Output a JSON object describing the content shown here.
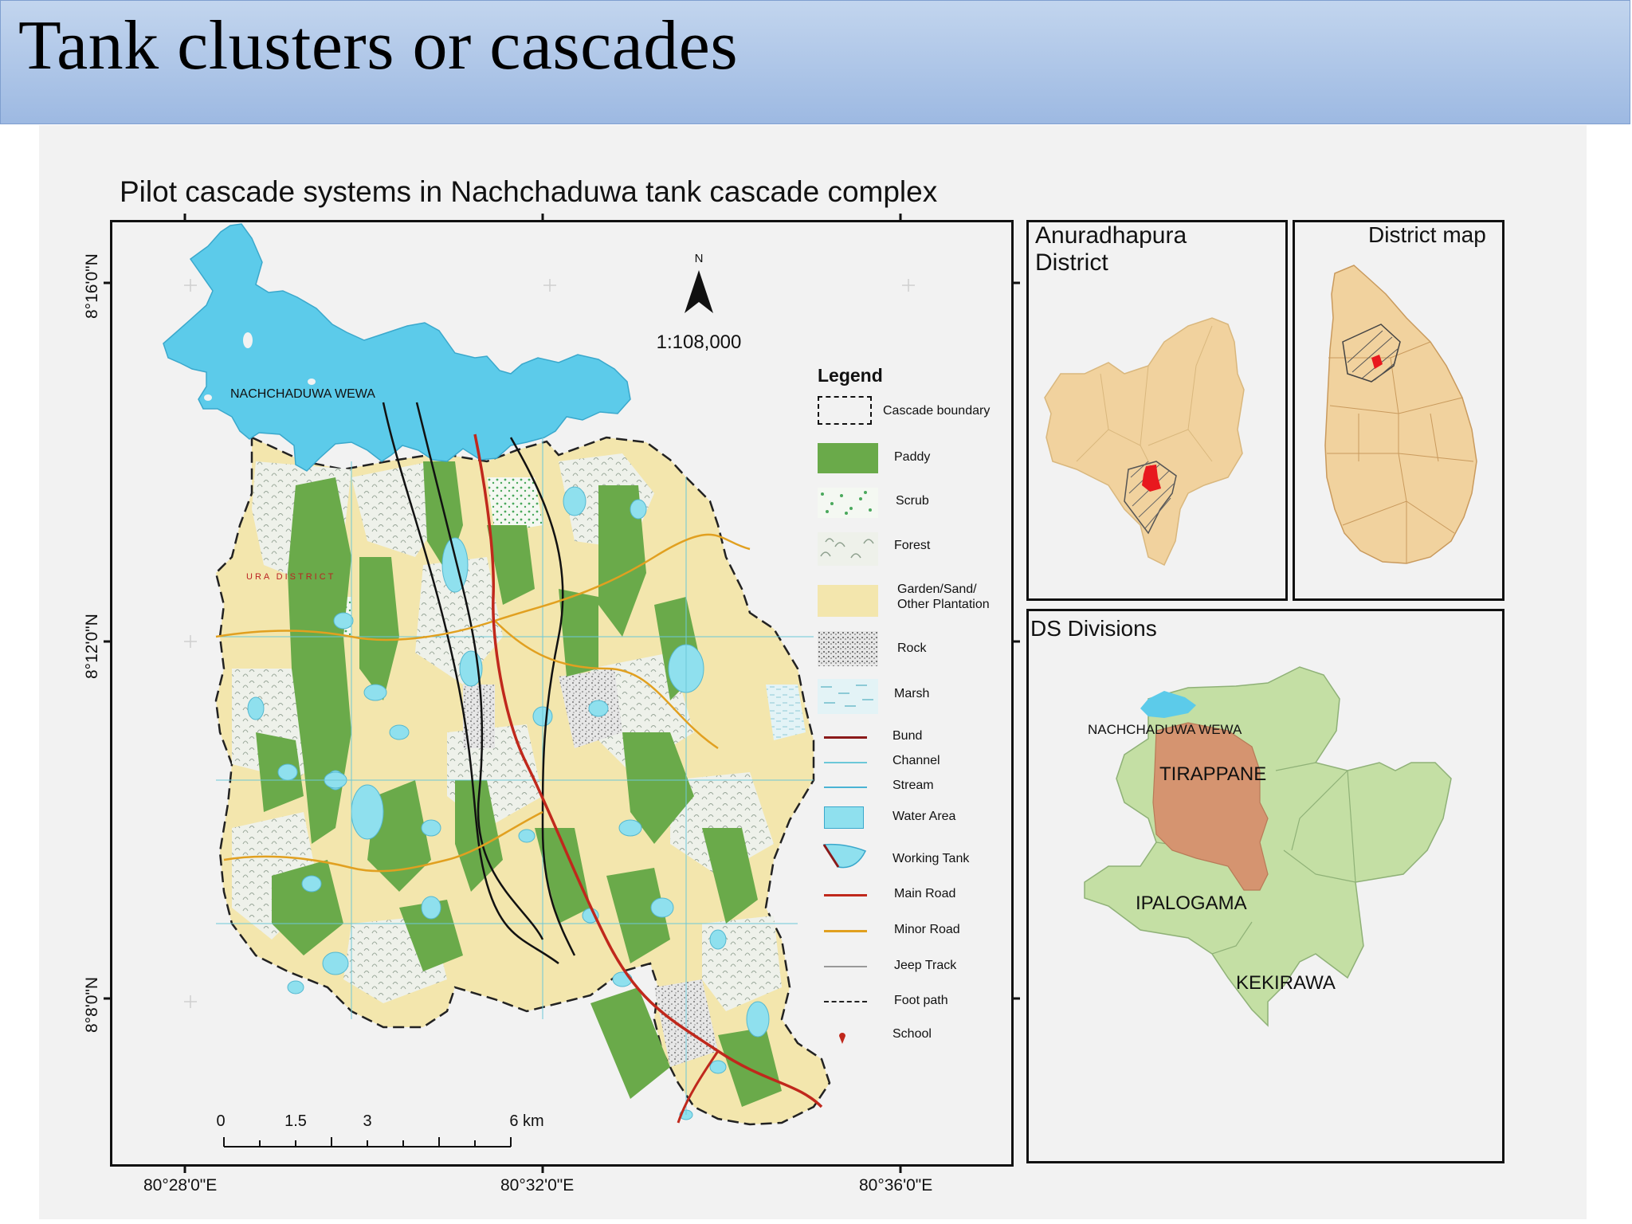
{
  "slide": {
    "title": "Tank clusters or cascades"
  },
  "map": {
    "title": "Pilot cascade systems in Nachchaduwa tank cascade complex",
    "north_label": "N",
    "scale_ratio": "1:108,000",
    "scalebar_labels": [
      "0",
      "1.5",
      "3",
      "6 km"
    ],
    "lake_label": "NACHCHADUWA WEWA",
    "district_text": "URA DISTRICT",
    "lat_labels": [
      "8°16'0\"N",
      "8°12'0\"N",
      "8°8'0\"N"
    ],
    "lon_labels": [
      "80°28'0\"E",
      "80°32'0\"E",
      "80°36'0\"E"
    ]
  },
  "legend": {
    "title": "Legend",
    "items": [
      {
        "label": "Cascade boundary",
        "icon": "dashed-box"
      },
      {
        "label": "Paddy",
        "color": "#6aaa4a"
      },
      {
        "label": "Scrub",
        "icon": "scrub-dots"
      },
      {
        "label": "Forest",
        "icon": "forest-pattern"
      },
      {
        "label": "Garden/Sand/ Other Plantation",
        "color": "#f3e6ad"
      },
      {
        "label": "Rock",
        "icon": "rock-stipple"
      },
      {
        "label": "Marsh",
        "icon": "marsh-pattern"
      },
      {
        "label": "Bund",
        "color": "#8b1a1a"
      },
      {
        "label": "Channel",
        "color": "#6cc8d8"
      },
      {
        "label": "Stream",
        "color": "#4ab4d4"
      },
      {
        "label": "Water Area",
        "color": "#8fe0ee"
      },
      {
        "label": "Working Tank",
        "icon": "tank-icon"
      },
      {
        "label": "Main Road",
        "color": "#c0281c"
      },
      {
        "label": "Minor Road",
        "color": "#e1a020"
      },
      {
        "label": "Jeep Track",
        "color": "#999999"
      },
      {
        "label": "Foot path",
        "icon": "dashed-line"
      },
      {
        "label": "School",
        "icon": "school-marker"
      }
    ]
  },
  "inset_district": {
    "title_line1": "Anuradhapura",
    "title_line2": "District"
  },
  "inset_country": {
    "title": "District map"
  },
  "inset_ds": {
    "title": "DS Divisions",
    "labels": [
      "NACHCHADUWA WEWA",
      "TIRAPPANE",
      "IPALOGAMA",
      "KEKIRAWA"
    ]
  },
  "colors": {
    "water": "#5ccbea",
    "paddy": "#6aaa4a",
    "garden": "#f3e6ad",
    "district_fill": "#f1d29e",
    "highlight": "#e8181e",
    "ds_green": "#c4dfa4",
    "ds_tirappane": "#d59470"
  }
}
